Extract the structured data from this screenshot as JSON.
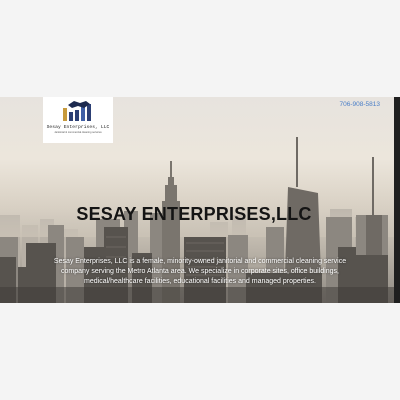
{
  "header": {
    "logo": {
      "company_name": "Sesay Enterprises, LLC",
      "tagline": "Janitorial & commercial cleaning services"
    },
    "phone": "706-908-5813"
  },
  "hero": {
    "title": "SESAY ENTERPRISES,LLC",
    "description": "Sesay Enterprises, LLC is a female, minority-owned janitorial and commercial cleaning service company serving the Metro Atlanta area. We specialize in corporate sites, office buildings, medical/healthcare facilities, educational facilities and managed properties."
  },
  "colors": {
    "page_background": "#f4f4f4",
    "phone_link": "#4a7fc8",
    "title": "#141414",
    "description": "#ffffff"
  }
}
